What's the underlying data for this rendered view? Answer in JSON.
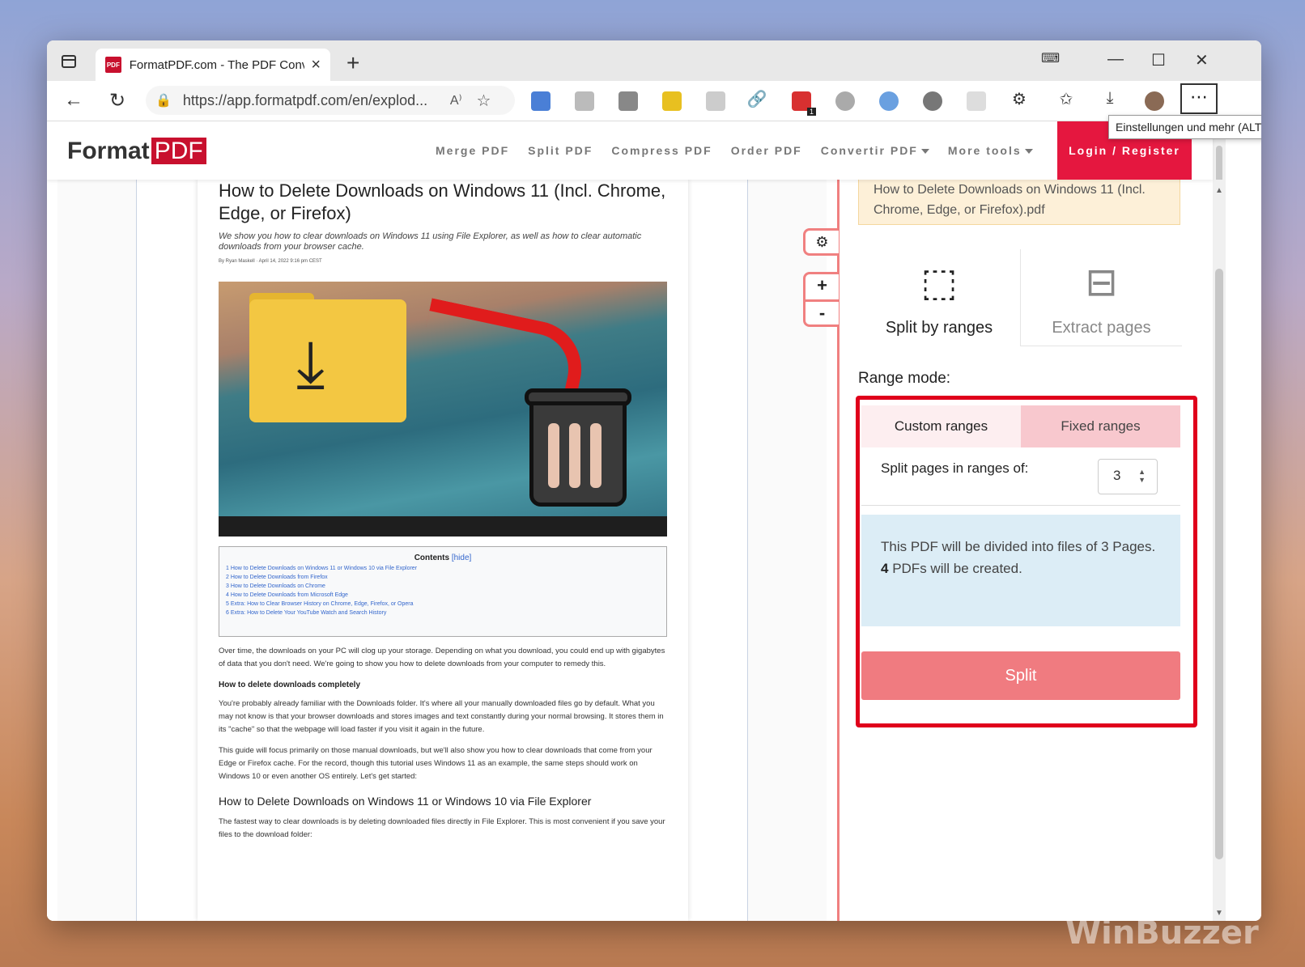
{
  "browser": {
    "tab_title": "FormatPDF.com - The PDF Conve",
    "favicon_text": "PDF",
    "url": "https://app.formatpdf.com/en/explod...",
    "tooltip": "Einstellungen und mehr (ALT+",
    "ext_badge": "1"
  },
  "site": {
    "logo_word": "Format",
    "logo_pdf": "PDF",
    "nav": {
      "merge": "Merge PDF",
      "split": "Split PDF",
      "compress": "Compress PDF",
      "order": "Order PDF",
      "convert": "Convertir PDF",
      "more": "More tools"
    },
    "login": "Login / Register"
  },
  "document": {
    "title": "How to Delete Downloads on Windows 11 (Incl. Chrome, Edge, or Firefox)",
    "subtitle": "We show you how to clear downloads on Windows 11 using File Explorer, as well as how to clear automatic downloads from your browser cache.",
    "byline": "By Ryan Maskell · April 14, 2022 9:16 pm CEST",
    "toc_title": "Contents",
    "toc_hide": "[hide]",
    "toc_items": [
      "1 How to Delete Downloads on Windows 11 or Windows 10 via File Explorer",
      "2 How to Delete Downloads from Firefox",
      "3 How to Delete Downloads on Chrome",
      "4 How to Delete Downloads from Microsoft Edge",
      "5 Extra: How to Clear Browser History on Chrome, Edge, Firefox, or Opera",
      "6 Extra: How to Delete Your YouTube Watch and Search History"
    ],
    "p1": "Over time, the downloads on your PC will clog up your storage. Depending on what you download, you could end up with gigabytes of data that you don't need. We're going to show you how to delete downloads from your computer to remedy this.",
    "h1": "How to delete downloads completely",
    "p2": "You're probably already familiar with the Downloads folder. It's where all your manually downloaded files go by default. What you may not know is that your browser downloads and stores images and text constantly during your normal browsing. It stores them in its \"cache\" so that the webpage will load faster if you visit it again in the future.",
    "p3": "This guide will focus primarily on those manual downloads, but we'll also show you how to clear downloads that come from your Edge or Firefox cache. For the record, though this tutorial uses Windows 11 as an example, the same steps should work on Windows 10 or even another OS entirely. Let's get started:",
    "h2": "How to Delete Downloads on Windows 11 or Windows 10 via File Explorer",
    "p4": "The fastest way to clear downloads is by deleting downloaded files directly in File Explorer. This is most convenient if you save your files to the download folder:"
  },
  "viewer_tools": {
    "zoom_in": "+",
    "zoom_out": "-"
  },
  "panel": {
    "filename": "How to Delete Downloads on Windows 11 (Incl. Chrome, Edge, or Firefox).pdf",
    "mode_split": "Split by ranges",
    "mode_extract": "Extract pages",
    "range_mode_label": "Range mode:",
    "tab_custom": "Custom ranges",
    "tab_fixed": "Fixed ranges",
    "split_pages_label": "Split pages in ranges of:",
    "range_value": "3",
    "info_line1": "This PDF will be divided into files of 3 Pages.",
    "info_count": "4",
    "info_line2": " PDFs will be created.",
    "split_button": "Split"
  },
  "watermark": "WinBuzzer"
}
